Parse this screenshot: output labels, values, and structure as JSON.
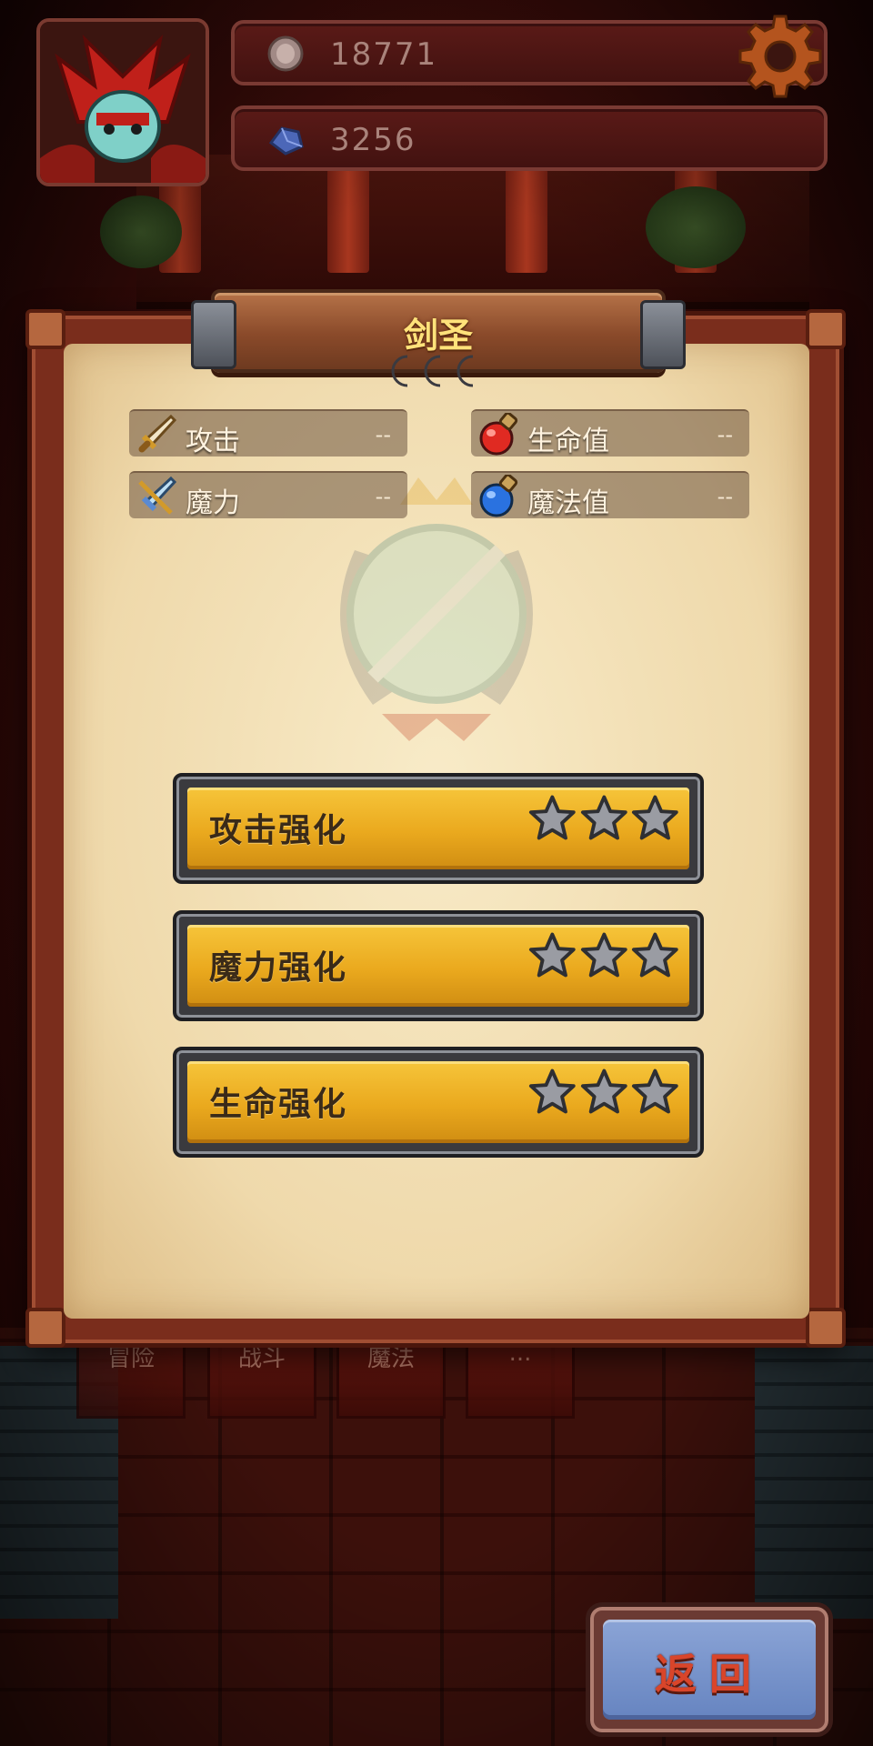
{
  "hud": {
    "currency_1_value": "18771",
    "currency_1_icon": "silver-coin-icon",
    "currency_2_value": "3256",
    "currency_2_icon": "blue-gem-icon",
    "settings_icon": "gear-icon"
  },
  "panel": {
    "title": "剑圣",
    "rank_icons": [
      "moon-icon",
      "moon-icon",
      "moon-icon"
    ]
  },
  "stats": [
    {
      "label": "攻击",
      "value": "--",
      "icon": "sword-icon"
    },
    {
      "label": "生命值",
      "value": "--",
      "icon": "red-potion-icon"
    },
    {
      "label": "魔力",
      "value": "--",
      "icon": "magic-sword-icon"
    },
    {
      "label": "魔法值",
      "value": "--",
      "icon": "blue-potion-icon"
    }
  ],
  "upgrades": [
    {
      "label": "攻击强化",
      "stars_filled": 0,
      "stars_total": 3
    },
    {
      "label": "魔力强化",
      "stars_filled": 0,
      "stars_total": 3
    },
    {
      "label": "生命强化",
      "stars_filled": 0,
      "stars_total": 3
    }
  ],
  "background_banners": [
    "冒险",
    "战斗",
    "魔法",
    "..."
  ],
  "back_button": {
    "label": "返回"
  },
  "colors": {
    "gold_button": "#eaa91e",
    "panel_frame": "#7a2d1c",
    "paper": "#f3e2bb",
    "title_text": "#ffe27a",
    "back_text": "#d9452a",
    "star_empty": "#9a9ca3"
  }
}
